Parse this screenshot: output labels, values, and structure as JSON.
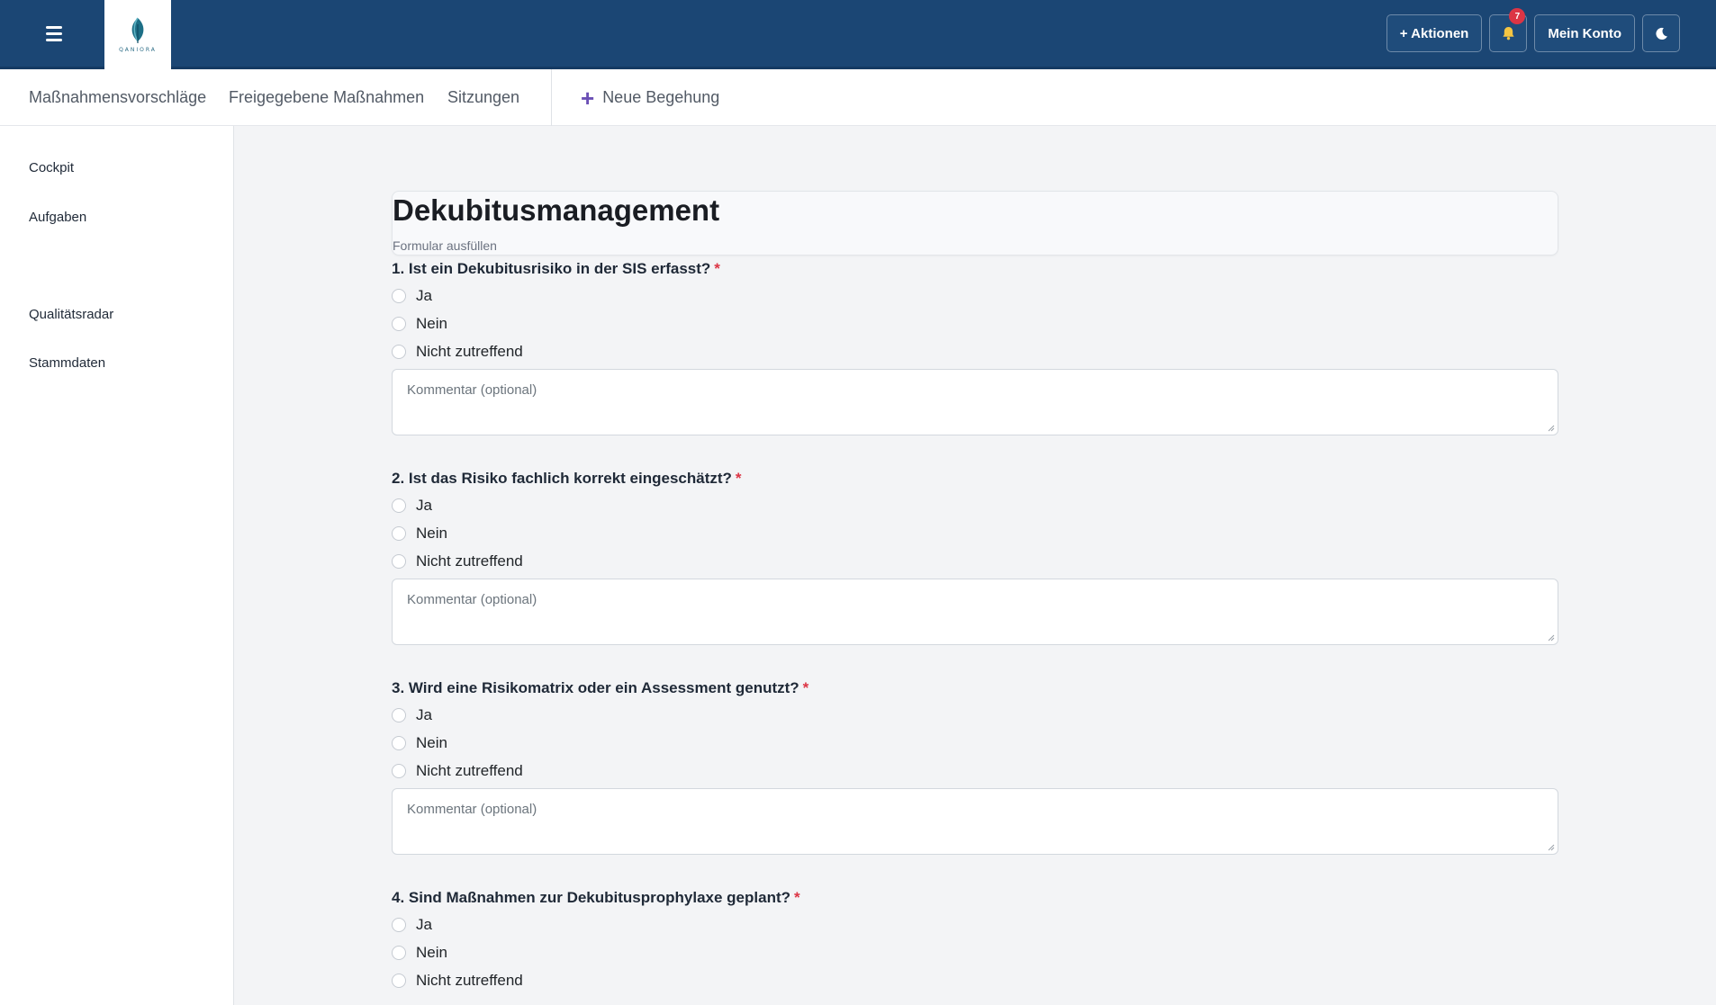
{
  "header": {
    "logo_text": "QANIORA",
    "actions_label": "+ Aktionen",
    "notifications_count": "7",
    "account_label": "Mein Konto"
  },
  "subnav": {
    "items": [
      "Maßnahmensvorschläge",
      "Freigegebene Maßnahmen",
      "Sitzungen"
    ],
    "new_label": "Neue Begehung"
  },
  "sidebar": {
    "items": [
      "Cockpit",
      "Aufgaben",
      "Qualitätsradar",
      "Stammdaten"
    ]
  },
  "form": {
    "title": "Dekubitusmanagement",
    "subtitle": "Formular ausfüllen",
    "comment_placeholder": "Kommentar (optional)",
    "options": [
      "Ja",
      "Nein",
      "Nicht zutreffend"
    ],
    "required_mark": "*",
    "questions": [
      "1. Ist ein Dekubitusrisiko in der SIS erfasst?",
      "2. Ist das Risiko fachlich korrekt eingeschätzt?",
      "3. Wird eine Risikomatrix oder ein Assessment genutzt?",
      "4. Sind Maßnahmen zur Dekubitusprophylaxe geplant?"
    ]
  },
  "colors": {
    "header_bg": "#1b4674",
    "accent_plus": "#6b4fb5",
    "required": "#dc3545",
    "badge": "#dc3545"
  },
  "icons": [
    "menu-icon",
    "leaf-logo-icon",
    "bell-icon",
    "moon-icon",
    "plus-icon"
  ]
}
